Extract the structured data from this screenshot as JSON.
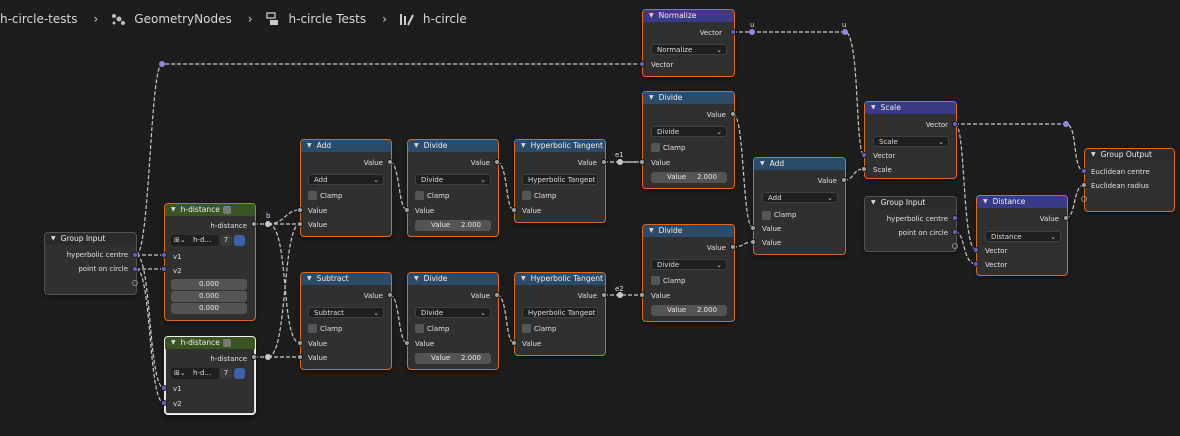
{
  "breadcrumb": {
    "items": [
      "h-circle-tests",
      "GeometryNodes",
      "h-circle Tests",
      "h-circle"
    ]
  },
  "nodes": {
    "normalize": {
      "title": "Normalize",
      "out": "Vector",
      "mode": "Normalize",
      "in": "Vector"
    },
    "divide_top": {
      "title": "Divide",
      "out": "Value",
      "mode": "Divide",
      "clamp": "Clamp",
      "in1": "Value",
      "in2_label": "Value",
      "in2_val": "2.000"
    },
    "divide_bottom": {
      "title": "Divide",
      "out": "Value",
      "mode": "Divide",
      "clamp": "Clamp",
      "in1": "Value",
      "in2_label": "Value",
      "in2_val": "2.000"
    },
    "add_right": {
      "title": "Add",
      "out": "Value",
      "mode": "Add",
      "clamp": "Clamp",
      "in1": "Value",
      "in2": "Value"
    },
    "scale": {
      "title": "Scale",
      "out": "Vector",
      "mode": "Scale",
      "in1": "Vector",
      "in2": "Scale"
    },
    "group_input_right": {
      "title": "Group Input",
      "o1": "hyperbolic centre",
      "o2": "point on circle"
    },
    "distance": {
      "title": "Distance",
      "out": "Value",
      "mode": "Distance",
      "in1": "Vector",
      "in2": "Vector"
    },
    "group_output": {
      "title": "Group Output",
      "i1": "Euclidean centre",
      "i2": "Euclidean radius"
    },
    "group_input_left": {
      "title": "Group Input",
      "o1": "hyperbolic centre",
      "o2": "point on circle"
    },
    "hdist_top": {
      "title": "h-distance",
      "out": "h-distance",
      "group": "h-d...",
      "users": "7",
      "in1": "v1",
      "in2": "v2",
      "vals": [
        "0.000",
        "0.000",
        "0.000"
      ]
    },
    "hdist_bottom": {
      "title": "h-distance",
      "out": "h-distance",
      "group": "h-d...",
      "users": "7",
      "in1": "v1",
      "in2": "v2"
    },
    "add_mid": {
      "title": "Add",
      "out": "Value",
      "mode": "Add",
      "clamp": "Clamp",
      "in1": "Value",
      "in2": "Value"
    },
    "subtract_mid": {
      "title": "Subtract",
      "out": "Value",
      "mode": "Subtract",
      "clamp": "Clamp",
      "in1": "Value",
      "in2": "Value"
    },
    "divide_mid_top": {
      "title": "Divide",
      "out": "Value",
      "mode": "Divide",
      "clamp": "Clamp",
      "in1": "Value",
      "in2_label": "Value",
      "in2_val": "2.000"
    },
    "divide_mid_bottom": {
      "title": "Divide",
      "out": "Value",
      "mode": "Divide",
      "clamp": "Clamp",
      "in1": "Value",
      "in2_label": "Value",
      "in2_val": "2.000"
    },
    "tanh_top": {
      "title": "Hyperbolic Tangent",
      "out": "Value",
      "mode": "Hyperbolic Tangent",
      "clamp": "Clamp",
      "in1": "Value"
    },
    "tanh_bottom": {
      "title": "Hyperbolic Tangent",
      "out": "Value",
      "mode": "Hyperbolic Tangent",
      "clamp": "Clamp",
      "in1": "Value"
    }
  },
  "wire_labels": {
    "u1": "u",
    "u2": "u",
    "b": "b",
    "e1": "e1",
    "e2": "e2"
  },
  "colors": {
    "node_border": "#e06a1b",
    "math_header": "#2a4c6a",
    "vector_header": "#3a3a86",
    "nested_header": "#3b5423",
    "socket_float": "#a1a1a1",
    "socket_vector": "#6363c7"
  }
}
